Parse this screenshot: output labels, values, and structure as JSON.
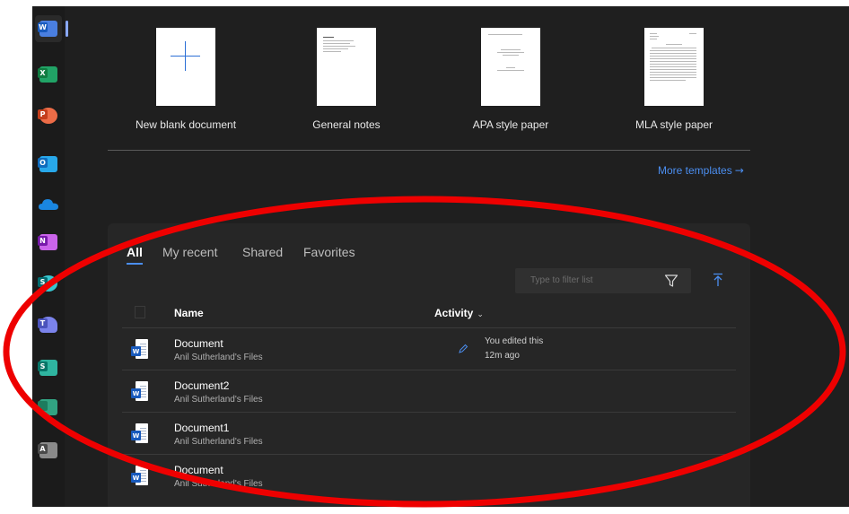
{
  "rail": {
    "apps": [
      {
        "name": "Word",
        "letter": "W",
        "color": "#2b62c9"
      },
      {
        "name": "Excel",
        "letter": "X",
        "color": "#1d7a43"
      },
      {
        "name": "PowerPoint",
        "letter": "P",
        "color": "#d24726"
      },
      {
        "name": "Outlook",
        "letter": "O",
        "color": "#0f6cbd"
      },
      {
        "name": "OneDrive",
        "letter": "",
        "color": "#1a86e0"
      },
      {
        "name": "OneNote",
        "letter": "N",
        "color": "#7a2fa8"
      },
      {
        "name": "SharePoint",
        "letter": "S",
        "color": "#087f7f"
      },
      {
        "name": "Teams",
        "letter": "T",
        "color": "#5b5fc7"
      },
      {
        "name": "Sway",
        "letter": "S",
        "color": "#138a7c"
      },
      {
        "name": "Planner",
        "letter": "",
        "color": "#1c8c6a"
      },
      {
        "name": "Admin",
        "letter": "A",
        "color": "#6b6b6b"
      }
    ]
  },
  "templates": [
    {
      "label": "New blank document"
    },
    {
      "label": "General notes"
    },
    {
      "label": "APA style paper"
    },
    {
      "label": "MLA style paper"
    }
  ],
  "more_templates": {
    "label": "More templates",
    "arrow": "→"
  },
  "tabs": [
    {
      "label": "All"
    },
    {
      "label": "My recent"
    },
    {
      "label": "Shared"
    },
    {
      "label": "Favorites"
    }
  ],
  "filter": {
    "placeholder": "Type to filter list"
  },
  "columns": {
    "name": "Name",
    "activity": "Activity",
    "activity_chevron": "⌄"
  },
  "files": [
    {
      "name": "Document",
      "location": "Anil Sutherland's Files",
      "activity": "You edited this",
      "activity_time": "12m ago"
    },
    {
      "name": "Document2",
      "location": "Anil Sutherland's Files",
      "activity": "",
      "activity_time": ""
    },
    {
      "name": "Document1",
      "location": "Anil Sutherland's Files",
      "activity": "",
      "activity_time": ""
    },
    {
      "name": "Document",
      "location": "Anil Sutherland's Files",
      "activity": "",
      "activity_time": ""
    }
  ],
  "annotation": {
    "color": "#ee0000"
  }
}
